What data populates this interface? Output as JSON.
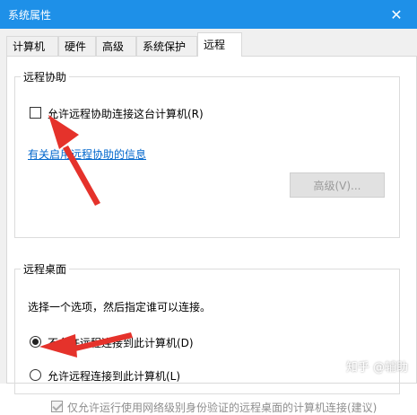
{
  "window": {
    "title": "系统属性",
    "close_glyph": "✕"
  },
  "tabs": [
    {
      "label": "计算机名"
    },
    {
      "label": "硬件"
    },
    {
      "label": "高级"
    },
    {
      "label": "系统保护"
    },
    {
      "label": "远程"
    }
  ],
  "remote_assistance": {
    "title": "远程协助",
    "checkbox_label": "允许远程协助连接这台计算机(R)",
    "checkbox_checked": false,
    "info_link": "有关启用远程协助的信息",
    "advanced_button": "高级(V)..."
  },
  "remote_desktop": {
    "title": "远程桌面",
    "instruction": "选择一个选项，然后指定谁可以连接。",
    "option_disallow": "不允许远程连接到此计算机(D)",
    "option_allow": "允许远程连接到此计算机(L)",
    "nla_label": "仅允许运行使用网络级别身份验证的远程桌面的计算机连接(建议)",
    "selected": "disallow"
  },
  "watermark": "知乎 @辅助",
  "colors": {
    "titlebar": "#1e90e8",
    "arrow": "#e5322b",
    "link": "#0066cc"
  }
}
